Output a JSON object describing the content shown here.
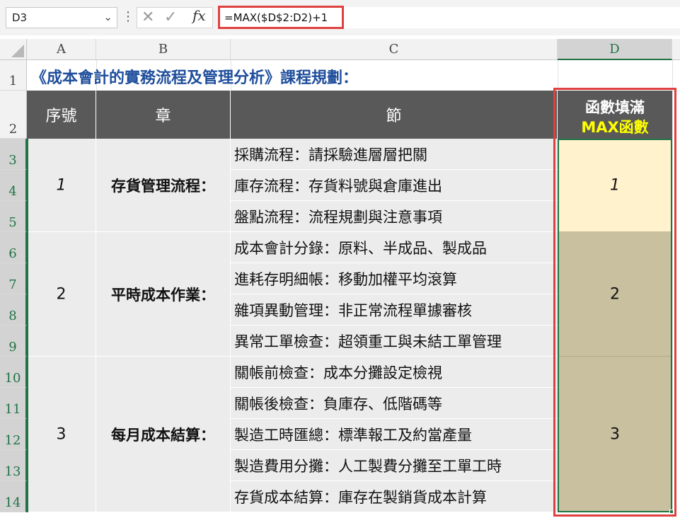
{
  "formula_bar": {
    "cell_ref": "D3",
    "formula": "=MAX($D$2:D2)+1",
    "fx_label": "fx"
  },
  "columns": [
    "A",
    "B",
    "C",
    "D"
  ],
  "rows": [
    "1",
    "2",
    "3",
    "4",
    "5",
    "6",
    "7",
    "8",
    "9",
    "10",
    "11",
    "12",
    "13",
    "14"
  ],
  "sheet": {
    "title": "《成本會計的實務流程及管理分析》課程規劃：",
    "headers": {
      "seq": "序號",
      "chapter": "章",
      "section": "節",
      "d_line1": "函數填滿",
      "d_line2": "MAX函數"
    },
    "groups": [
      {
        "seq": "1",
        "chapter": "存貨管理流程：",
        "d_value": "1",
        "sections": [
          "採購流程：請採驗進層層把關",
          "庫存流程：存貨料號與倉庫進出",
          "盤點流程：流程規劃與注意事項"
        ]
      },
      {
        "seq": "2",
        "chapter": "平時成本作業：",
        "d_value": "2",
        "sections": [
          "成本會計分錄：原料、半成品、製成品",
          "進耗存明細帳：移動加權平均滾算",
          "雜項異動管理：非正常流程單據審核",
          "異常工單檢查：超領重工與未結工單管理"
        ]
      },
      {
        "seq": "3",
        "chapter": "每月成本結算：",
        "d_value": "3",
        "sections": [
          "關帳前檢查：成本分攤設定檢視",
          "關帳後檢查：負庫存、低階碼等",
          "製造工時匯總：標準報工及約當產量",
          "製造費用分攤：人工製費分攤至工單工時",
          "存貨成本結算：庫存在製銷貨成本計算"
        ]
      }
    ]
  },
  "colors": {
    "header_bg": "#595959",
    "title_text": "#1f4e9c",
    "d_highlight": "#ffff00",
    "d3_fill": "#fff2cc",
    "d_fill": "#c9c0a0",
    "annotation_red": "#e04040",
    "selection_green": "#217346"
  }
}
